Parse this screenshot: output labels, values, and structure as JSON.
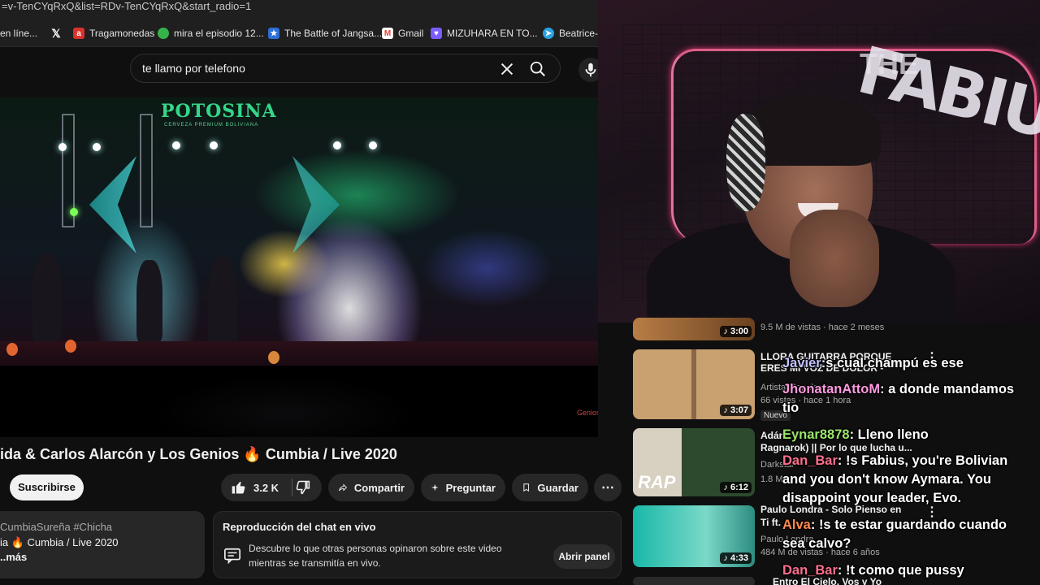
{
  "browser": {
    "url": "=v-TenCYqRxQ&list=RDv-TenCYqRxQ&start_radio=1",
    "bookmarks": [
      {
        "label": "en líne...",
        "icon": "page-icon",
        "color": "#444444"
      },
      {
        "label": "",
        "icon": "x-logo-icon",
        "color": "#000000"
      },
      {
        "label": "Tragamonedas",
        "icon": "tragamonedas-icon",
        "color": "#d9332b"
      },
      {
        "label": "mira el episodio 12...",
        "icon": "leaf-icon",
        "color": "#36b24a"
      },
      {
        "label": "The Battle of Jangsa...",
        "icon": "star-icon",
        "color": "#2b6fd6"
      },
      {
        "label": "Gmail",
        "icon": "gmail-icon",
        "color": "#ea4335"
      },
      {
        "label": "MIZUHARA EN TO...",
        "icon": "heart-icon",
        "color": "#7a5cff"
      },
      {
        "label": "Beatrice-R",
        "icon": "telegram-icon",
        "color": "#2aa3e0"
      }
    ]
  },
  "search": {
    "query": "te llamo por telefono"
  },
  "video": {
    "overlay_brand": "POTOSINA",
    "overlay_sub": "CERVEZA PREMIUM BOLIVIANA",
    "watermark": "Genios",
    "title": "ida & Carlos Alarcón y Los Genios 🔥 Cumbia / Live 2020"
  },
  "actions": {
    "subscribe": "Suscribirse",
    "likes": "3.2 K",
    "share": "Compartir",
    "ask": "Preguntar",
    "save": "Guardar"
  },
  "description": {
    "tags": "CumbiaSureña #Chicha",
    "line2": "ia 🔥 Cumbia / Live 2020",
    "more": "..más"
  },
  "replay": {
    "title": "Reproducción del chat en vivo",
    "text1": "Descubre lo que otras personas opinaron sobre este video",
    "text2": "mientras se transmitía en vivo.",
    "button": "Abrir panel"
  },
  "recommendations": [
    {
      "title": "",
      "meta1": "9.5 M de vistas · hace 2 meses",
      "meta2": "",
      "duration": "3:00",
      "badge": ""
    },
    {
      "title": "LLORA GUITARRA PORQUE",
      "title2": "ERES MI VOZ DE DOLOR -",
      "meta1": "ArtistasPopulares",
      "meta2": "66 vistas · hace 1 hora",
      "duration": "3:07",
      "badge": "Nuevo"
    },
    {
      "title": "Adán",
      "title2": "Ragnarok) || Por lo que lucha u...",
      "meta1": "Darkstar",
      "meta2": "1.8 M",
      "duration": "6:12",
      "badge": ""
    },
    {
      "title": "Paulo Londra - Solo Pienso en",
      "title2": "Ti ft.",
      "meta1": "Paulo Londra",
      "meta2": "484 M de vistas · hace 6 años",
      "duration": "4:33",
      "badge": ""
    },
    {
      "title": "Entro El Cielo, Vos y Yo",
      "meta1": "",
      "meta2": "",
      "duration": "",
      "badge": ""
    }
  ],
  "chat": [
    {
      "user": "Javier",
      "text": ":s cual champú es ese",
      "color": "#c2c2ff"
    },
    {
      "user": "JhonatanAttoM",
      "text": ": a donde mandamos tio",
      "color": "#ff9ae0"
    },
    {
      "user": "Eynar8878",
      "text": ": Lleno lleno",
      "color": "#9be36b"
    },
    {
      "user": "Dan_Bar",
      "text": ": !s Fabius, you're Bolivian and you don't know Aymara. You disappoint your leader, Evo.",
      "color": "#ff6f8e"
    },
    {
      "user": "Alva",
      "text": ": !s te estar guardando cuando sea calvo?",
      "color": "#ff8a4d"
    },
    {
      "user": "Dan_Bar",
      "text": ": !t como que pussy",
      "color": "#ff6f8e"
    }
  ]
}
